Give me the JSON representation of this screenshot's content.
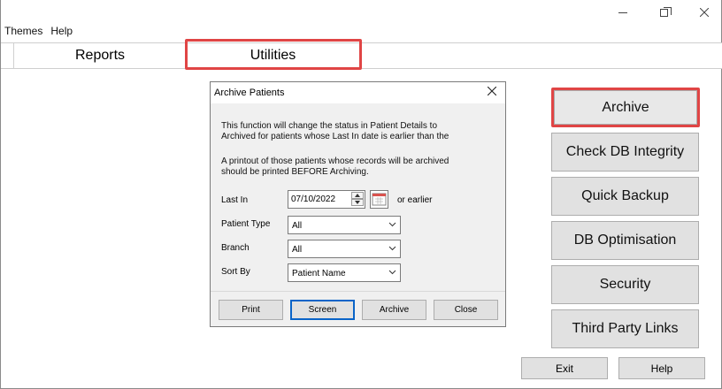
{
  "menu": {
    "themes": "Themes",
    "help": "Help"
  },
  "tabs": {
    "reports": "Reports",
    "utilities": "Utilities"
  },
  "side_buttons": {
    "archive": "Archive",
    "check_db": "Check DB Integrity",
    "quick_backup": "Quick Backup",
    "db_optimisation": "DB Optimisation",
    "security": "Security",
    "third_party": "Third Party Links"
  },
  "bottom_buttons": {
    "exit": "Exit",
    "help": "Help"
  },
  "dialog": {
    "title": "Archive Patients",
    "text1_line1": "This function will change the status in Patient Details to",
    "text1_line2": "Archived for patients whose Last In date is earlier than the",
    "text2_line1": "A printout of those patients whose records will be archived",
    "text2_line2": "should be printed BEFORE Archiving.",
    "last_in_label": "Last In",
    "last_in_value": "07/10/2022",
    "or_earlier": "or earlier",
    "patient_type_label": "Patient Type",
    "patient_type_value": "All",
    "branch_label": "Branch",
    "branch_value": "All",
    "sort_by_label": "Sort By",
    "sort_by_value": "Patient Name",
    "print_label": "Print",
    "screen_label": "Screen",
    "archive_label": "Archive",
    "close_label": "Close"
  },
  "colors": {
    "highlight": "#e04545",
    "button_face": "#e1e1e1",
    "dialog_bg": "#f0f0f0",
    "focus": "#0a64c8"
  }
}
